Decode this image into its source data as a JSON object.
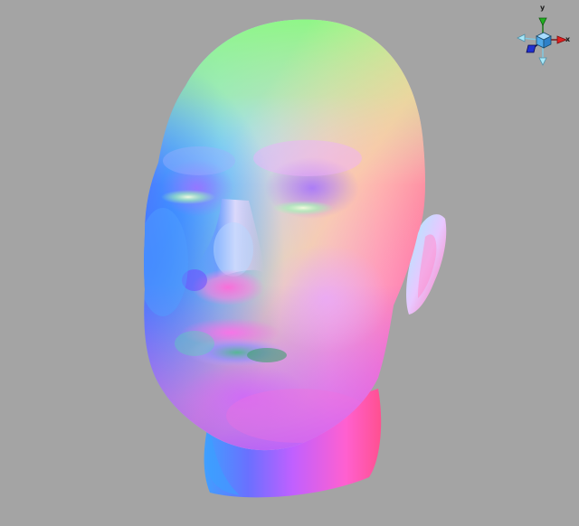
{
  "viewport": {
    "background_color": "#a4a4a4",
    "model": "normal-shaded-head",
    "render_mode": "surface-normals-rgb"
  },
  "orientation_gizmo": {
    "y_label": "y",
    "x_label": "x",
    "colors": {
      "x_axis": "#e02020",
      "y_axis": "#20b020",
      "z_axis": "#2030d0",
      "cube": "#4fa8e8",
      "neg_axes": "#a8e8f8"
    },
    "icons": [
      "axis-cube-icon",
      "x-arrow-icon",
      "y-arrow-icon",
      "z-arrow-icon"
    ]
  }
}
